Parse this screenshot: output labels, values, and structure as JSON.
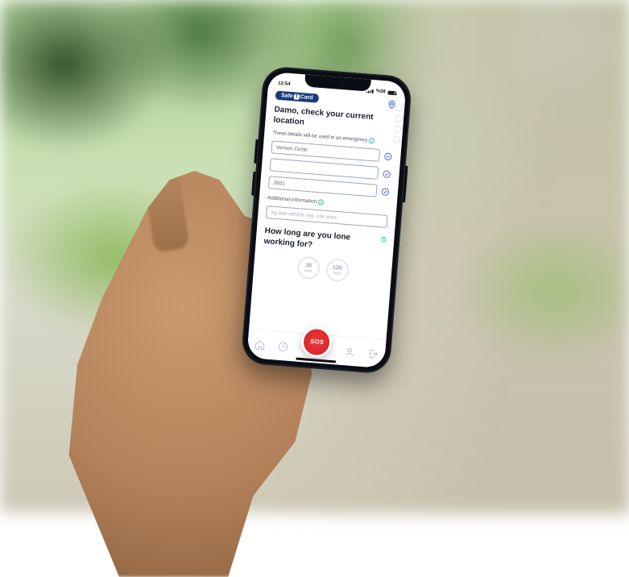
{
  "statusbar": {
    "time": "12:54",
    "batteryPct": "38"
  },
  "brand": {
    "left": "Safe",
    "mid": "T",
    "right": "Card"
  },
  "page": {
    "heading": "Damo, check your current location",
    "notice": "These details will be used in an emergency",
    "fields": {
      "address1": "Vernon Circle",
      "address2": "",
      "postcode": "2601"
    },
    "additionalLabel": "Additional information",
    "additionalPlaceholder": "eg add vehicle reg, risk area",
    "durationHeading": "How long are you lone working for?",
    "durations": [
      {
        "value": "30",
        "unit": "mins"
      },
      {
        "value": "120",
        "unit": "mins"
      }
    ]
  },
  "sos": "SOS"
}
